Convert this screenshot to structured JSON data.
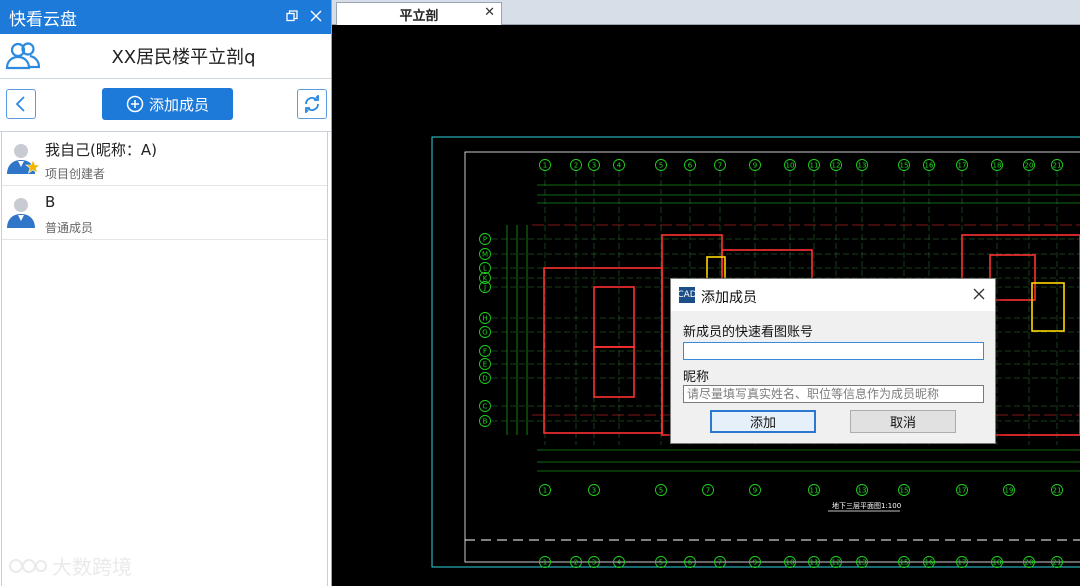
{
  "app": {
    "title": "快看云盘"
  },
  "project": {
    "name": "XX居民楼平立剖q"
  },
  "toolbar": {
    "add_member_label": "添加成员"
  },
  "members": [
    {
      "name": "我自己(昵称：A)",
      "role": "项目创建者"
    },
    {
      "name": "B",
      "role": "普通成员"
    }
  ],
  "tabs": [
    {
      "label": "平立剖"
    }
  ],
  "dialog": {
    "title": "添加成员",
    "account_label": "新成员的快速看图账号",
    "account_value": "",
    "nickname_label": "昵称",
    "nickname_placeholder": "请尽量填写真实姓名、职位等信息作为成员昵称",
    "add_button": "添加",
    "cancel_button": "取消"
  },
  "drawing": {
    "title": "地下三层平面图1:100",
    "top_axes": [
      "1",
      "2",
      "3",
      "4",
      "5",
      "6",
      "7",
      "9",
      "10",
      "11",
      "12",
      "13",
      "15",
      "16",
      "17",
      "18",
      "20",
      "21"
    ],
    "bottom_axes": [
      "1",
      "3",
      "5",
      "7",
      "9",
      "11",
      "13",
      "15",
      "17",
      "19",
      "21"
    ],
    "left_axes": [
      "P",
      "M",
      "L",
      "K",
      "J",
      "H",
      "G",
      "F",
      "E",
      "D",
      "C",
      "B",
      "A"
    ]
  },
  "watermark": {
    "text": "大数跨境"
  },
  "colors": {
    "accent": "#1e7ad9",
    "cad_wall": "#ff3030",
    "cad_line": "#21d321",
    "cad_yellow": "#ffd800",
    "cad_frame": "#32d3e0"
  }
}
